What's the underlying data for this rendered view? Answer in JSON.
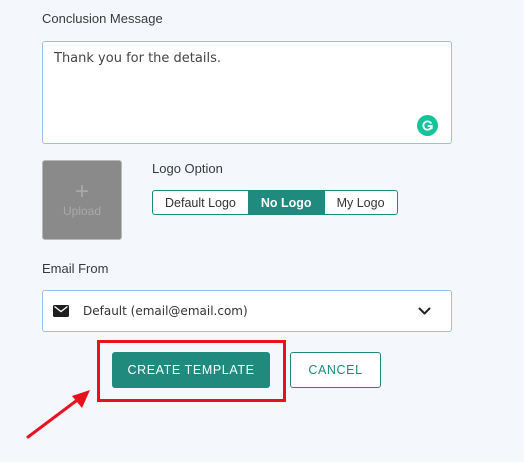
{
  "conclusion": {
    "label": "Conclusion Message",
    "value": "Thank you for the details."
  },
  "upload": {
    "plus": "+",
    "label": "Upload"
  },
  "logo_option": {
    "label": "Logo Option",
    "options": [
      "Default Logo",
      "No Logo",
      "My Logo"
    ],
    "selected": "No Logo"
  },
  "email_from": {
    "label": "Email From",
    "selected": "Default (email@email.com)"
  },
  "actions": {
    "create_label": "CREATE TEMPLATE",
    "cancel_label": "CANCEL"
  },
  "colors": {
    "accent": "#1f8a7d",
    "highlight": "#e8121f",
    "grammarly": "#15c39a"
  },
  "icons": [
    "grammarly-icon",
    "plus-icon",
    "mail-icon",
    "chevron-down-icon",
    "arrow-icon"
  ]
}
